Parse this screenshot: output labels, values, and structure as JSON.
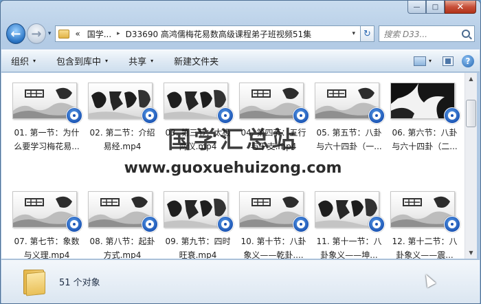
{
  "window": {
    "minimize_glyph": "—",
    "maximize_glyph": "□",
    "close_glyph": "✕"
  },
  "nav": {
    "back_glyph": "←",
    "forward_glyph": "→",
    "history_glyph": "▾",
    "breadcrumb_root": "«",
    "breadcrumb_1": "国学...",
    "breadcrumb_sep": "▸",
    "breadcrumb_2": "D33690 高鸿儒梅花易数高级课程弟子班视频51集",
    "address_dropdown": "▾",
    "refresh_glyph": "↻",
    "search_placeholder": "搜索 D33..."
  },
  "toolbar": {
    "organize": "组织",
    "include_library": "包含到库中",
    "share": "共享",
    "new_folder": "新建文件夹",
    "caret": "▾",
    "help": "?"
  },
  "files": [
    {
      "label": "01. 第一节：为什么要学习梅花易...",
      "thumb": "logo"
    },
    {
      "label": "02. 第二节：介绍易经.mp4",
      "thumb": "calligraphy"
    },
    {
      "label": "03. 第三节：太极两仪.mp4",
      "thumb": "calligraphy"
    },
    {
      "label": "04. 第四节：五行与干支.mp4",
      "thumb": "logo"
    },
    {
      "label": "05. 第五节：八卦与六十四卦（一...",
      "thumb": "logo"
    },
    {
      "label": "06. 第六节：八卦与六十四卦（二...",
      "thumb": "dark"
    },
    {
      "label": "07. 第七节：象数与义理.mp4",
      "thumb": "logo"
    },
    {
      "label": "08. 第八节：起卦方式.mp4",
      "thumb": "logo"
    },
    {
      "label": "09. 第九节：四时旺衰.mp4",
      "thumb": "calligraphy"
    },
    {
      "label": "10. 第十节：八卦象义——乾卦....",
      "thumb": "logo"
    },
    {
      "label": "11. 第十一节：八卦象义——坤...",
      "thumb": "calligraphy"
    },
    {
      "label": "12. 第十二节：八卦象义——震...",
      "thumb": "logo"
    }
  ],
  "watermark": {
    "title": "国学汇总站",
    "url": "www.guoxuehuizong.com"
  },
  "status": {
    "count_text": "51 个对象"
  },
  "scrollbar": {
    "up": "▲",
    "down": "▼"
  }
}
